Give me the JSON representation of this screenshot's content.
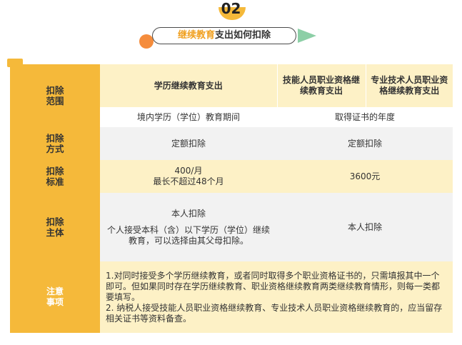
{
  "header": {
    "number": "02",
    "title_highlight": "继续教育",
    "title_rest": "支出如何扣除"
  },
  "table": {
    "scope": {
      "label": "扣除\n范围",
      "col1": "学历继续教育支出",
      "col2": "技能人员职业资格继续教育支出",
      "col3": "专业技术人员职业资格继续教育支出",
      "period1": "境内学历（学位）教育期间",
      "period2": "取得证书的年度"
    },
    "method": {
      "label": "扣除\n方式",
      "col1": "定额扣除",
      "col2": "定额扣除"
    },
    "standard": {
      "label": "扣除\n标准",
      "col1_line1": "400/月",
      "col1_line2": "最长不超过48个月",
      "col2": "3600元"
    },
    "subject": {
      "label": "扣除\n主体",
      "col1_line1": "本人扣除",
      "col1_line2": "个人接受本科（含）以下学历（学位）继续教育，可以选择由其父母扣除。",
      "col2": "本人扣除"
    },
    "notes": {
      "label": "注意\n事项",
      "line1": "1.对同时接受多个学历继续教育，或者同时取得多个职业资格证书的，只需填报其中一个即可。但如果同时存在学历继续教育、职业资格继续教育两类继续教育情形，则每一类都要填写。",
      "line2": "2. 纳税人接受技能人员职业资格继续教育、专业技术人员职业资格继续教育的，应当留存相关证书等资料备查。"
    }
  },
  "colors": {
    "accent": "#f5b93a",
    "light_yellow": "#fdf1c6",
    "gray": "#f2f2f2",
    "title_highlight": "#f0a020",
    "triangle": "#8ccfa6",
    "dot": "#f58c3c"
  }
}
